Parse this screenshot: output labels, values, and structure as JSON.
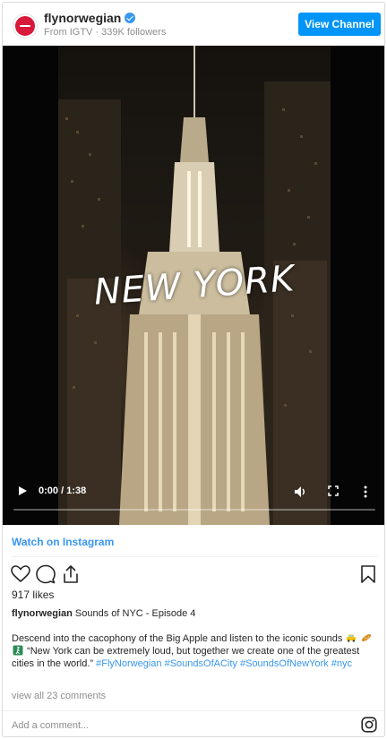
{
  "header": {
    "username": "flynorwegian",
    "subline": "From IGTV ·  339K followers",
    "view_channel_label": "View Channel",
    "brand_color": "#d81939",
    "accent_color": "#0095f6"
  },
  "video": {
    "overlay_title": "NEW YORK",
    "time": "0:00 / 1:38",
    "progress": 0
  },
  "watch_link": "Watch on Instagram",
  "post": {
    "likes": "917 likes",
    "caption_user": "flynorwegian",
    "caption_text": "Sounds of NYC - Episode 4",
    "desc_part1": "Descend into the cacophony of the Big Apple and listen to the iconic sounds",
    "desc_part2": "“New York can be extremely loud, but together we create one of the greatest cities in the world.”",
    "hashtags": [
      "#FlyNorwegian",
      "#SoundsOfACity",
      "#SoundsOfNewYork",
      "#nyc"
    ],
    "view_comments": "view all 23 comments",
    "comment_placeholder": "Add a comment..."
  },
  "icons": [
    "verified-icon",
    "play-icon",
    "volume-icon",
    "fullscreen-icon",
    "more-icon",
    "heart-icon",
    "comment-icon",
    "share-icon",
    "bookmark-icon",
    "taxi-emoji",
    "baguette-emoji",
    "person-walking-emoji",
    "instagram-icon"
  ]
}
